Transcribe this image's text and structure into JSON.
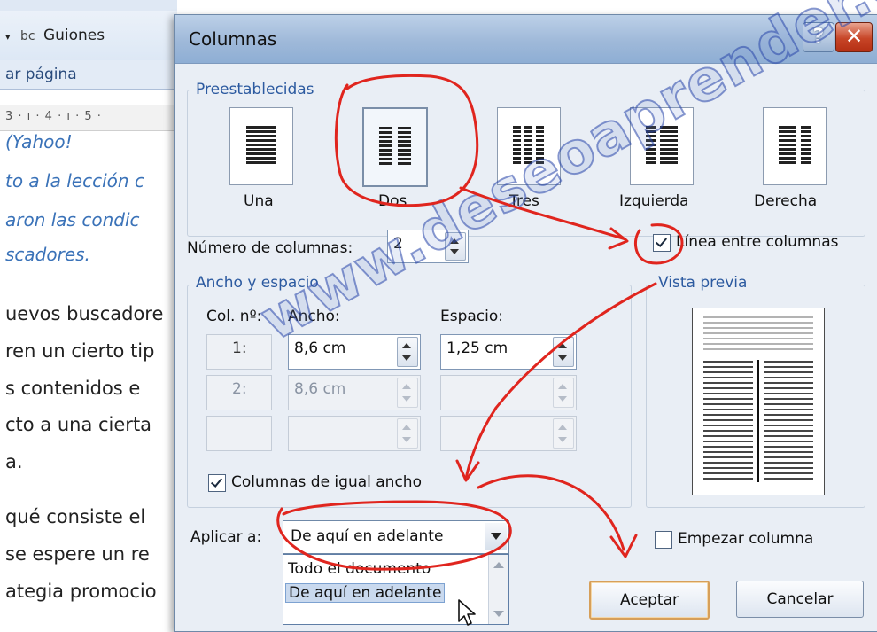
{
  "document": {
    "ribbon_hyphenation": "Guiones",
    "group_label": "ar página",
    "ruler_text": "3 · ı · 4 · ı · 5 ·",
    "lines_italic": [
      "(Yahoo!",
      "to a la lección c",
      "aron las condic",
      "scadores."
    ],
    "lines_body": [
      "uevos buscadore",
      "ren un cierto tip",
      "s contenidos e",
      "cto a una cierta",
      "a.",
      "qué consiste el",
      "se espere un re",
      "ategia promocio"
    ]
  },
  "dialog": {
    "title": "Columnas",
    "help_label": "?",
    "close_label": "✕",
    "presets_label": "Preestablecidas",
    "presets": [
      {
        "label": "Una",
        "icon": "one-column-icon"
      },
      {
        "label": "Dos",
        "icon": "two-columns-icon"
      },
      {
        "label": "Tres",
        "icon": "three-columns-icon"
      },
      {
        "label": "Izquierda",
        "icon": "left-column-icon"
      },
      {
        "label": "Derecha",
        "icon": "right-column-icon"
      }
    ],
    "selected_preset": "Dos",
    "num_columns_label": "Número de columnas:",
    "num_columns_value": "2",
    "line_between_label": "Línea entre columnas",
    "line_between_checked": true,
    "width_spacing_label": "Ancho y espacio",
    "col_header": "Col. nº:",
    "width_header": "Ancho:",
    "spacing_header": "Espacio:",
    "rows": [
      {
        "col": "1:",
        "width": "8,6 cm",
        "spacing": "1,25 cm",
        "enabled": true
      },
      {
        "col": "2:",
        "width": "8,6 cm",
        "spacing": "",
        "enabled": false
      },
      {
        "col": "",
        "width": "",
        "spacing": "",
        "enabled": false
      }
    ],
    "equal_width_label": "Columnas de igual ancho",
    "equal_width_checked": true,
    "preview_label": "Vista previa",
    "apply_label": "Aplicar a:",
    "apply_value": "De aquí en adelante",
    "apply_options": [
      "Todo el documento",
      "De aquí en adelante"
    ],
    "start_column_label": "Empezar columna",
    "start_column_checked": false,
    "ok_label": "Aceptar",
    "cancel_label": "Cancelar"
  },
  "watermark": "www.deseoaprender.com",
  "colors": {
    "section_blue": "#2c5aa0",
    "annotation_red": "#e0251e",
    "close_red": "#c74527"
  }
}
